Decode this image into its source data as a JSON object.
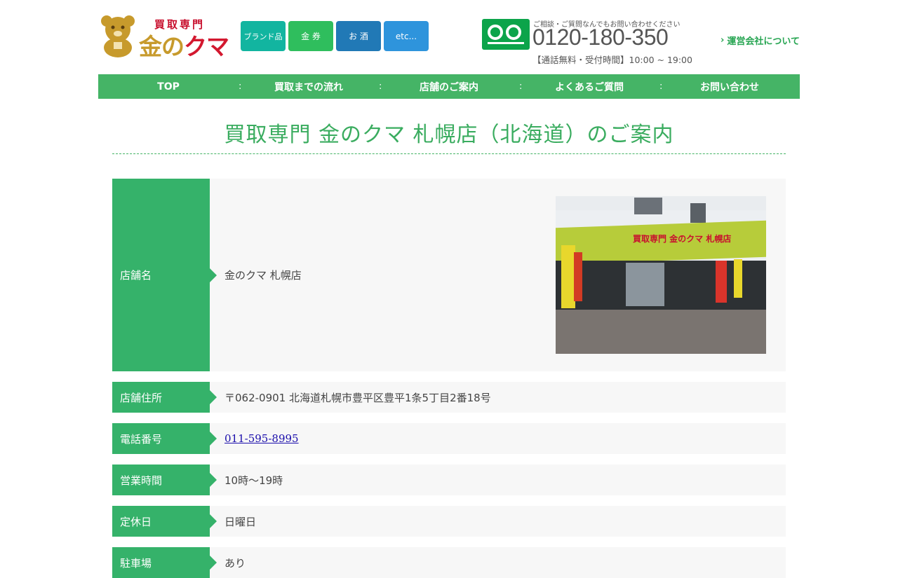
{
  "header": {
    "logo_sub": "買取専門",
    "logo_main_gold": "金の",
    "logo_main_red": "クマ",
    "categories": [
      "ブランド品",
      "金 券",
      "お 酒",
      "etc..."
    ],
    "phone_note": "ご相談・ご質問なんでもお問い合わせください",
    "phone_number": "0120-180-350",
    "phone_hours": "【通話無料・受付時間】10:00 ~ 19:00",
    "company_link": "運営会社について"
  },
  "nav": {
    "items": [
      "TOP",
      "買取までの流れ",
      "店舗のご案内",
      "よくあるご質問",
      "お問い合わせ"
    ],
    "separator": ":"
  },
  "page_title": "買取専門 金のクマ 札幌店（北海道）のご案内",
  "store_image_sign": "買取専門 金のクマ 札幌店",
  "info": {
    "rows": [
      {
        "label": "店舗名",
        "value": "金のクマ 札幌店"
      },
      {
        "label": "店舗住所",
        "value": "〒062-0901 北海道札幌市豊平区豊平1条5丁目2番18号"
      },
      {
        "label": "電話番号",
        "value": "011-595-8995"
      },
      {
        "label": "営業時間",
        "value": "10時〜19時"
      },
      {
        "label": "定休日",
        "value": "日曜日"
      },
      {
        "label": "駐車場",
        "value": "あり"
      }
    ]
  },
  "colors": {
    "nav_green": "#45b466",
    "label_green": "#35b26a",
    "title_green": "#3aac5f",
    "brand_red": "#d3182f",
    "brand_gold": "#c79a2c"
  }
}
